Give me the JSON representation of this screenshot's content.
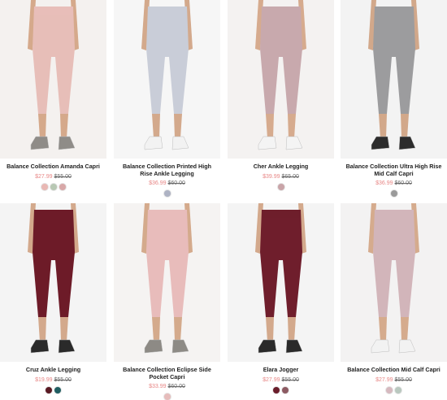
{
  "products": [
    {
      "title": "Balance Collection Amanda Capri",
      "sale": "$27.99",
      "orig": "$55.00",
      "swatches": [
        {
          "name": "blush",
          "color": "#e9b8b4"
        },
        {
          "name": "sage",
          "color": "#b8c8b4"
        },
        {
          "name": "rose",
          "color": "#d8a8a8"
        }
      ],
      "image": {
        "bg": "#f4f1ef",
        "fabric": "#e7beb8",
        "shoe": "#8f8c88",
        "skin": "#d5a98b"
      }
    },
    {
      "title": "Balance Collection Printed High Rise Ankle Legging",
      "sale": "$36.99",
      "orig": "$60.00",
      "swatches": [
        {
          "name": "camo-print",
          "color": "#aeb3c4"
        }
      ],
      "image": {
        "bg": "#f6f6f6",
        "fabric": "#c9cdd8",
        "shoe": "#f2f2f2",
        "skin": "#d3a98c"
      }
    },
    {
      "title": "Cher Ankle Legging",
      "sale": "$39.99",
      "orig": "$65.00",
      "swatches": [
        {
          "name": "mauve",
          "color": "#c9a4a8"
        }
      ],
      "image": {
        "bg": "#f4f2f1",
        "fabric": "#c8a9ad",
        "shoe": "#f4f4f4",
        "skin": "#d6ab8e"
      }
    },
    {
      "title": "Balance Collection Ultra High Rise Mid Calf Capri",
      "sale": "$36.99",
      "orig": "$60.00",
      "swatches": [
        {
          "name": "grey",
          "color": "#9a9a9a"
        }
      ],
      "image": {
        "bg": "#f3f3f3",
        "fabric": "#9c9c9e",
        "shoe": "#2c2c2c",
        "skin": "#d2a88a"
      }
    },
    {
      "title": "Cruz Ankle Legging",
      "sale": "$19.99",
      "orig": "$55.00",
      "swatches": [
        {
          "name": "wine",
          "color": "#5a1a23"
        },
        {
          "name": "teal",
          "color": "#1f5d61"
        }
      ],
      "image": {
        "bg": "#f4f4f4",
        "fabric": "#6d1b28",
        "shoe": "#2a2a2a",
        "skin": "#d3a98c"
      }
    },
    {
      "title": "Balance Collection Eclipse Side Pocket Capri",
      "sale": "$33.99",
      "orig": "$60.00",
      "swatches": [
        {
          "name": "blush",
          "color": "#e6bcbb"
        }
      ],
      "image": {
        "bg": "#f5f3f2",
        "fabric": "#e8bcbb",
        "shoe": "#8d8a85",
        "skin": "#d4aa8c"
      }
    },
    {
      "title": "Elara Jogger",
      "sale": "$27.99",
      "orig": "$55.00",
      "swatches": [
        {
          "name": "wine",
          "color": "#6a1d2a"
        },
        {
          "name": "mauve",
          "color": "#8c5a62"
        }
      ],
      "image": {
        "bg": "#f4f4f4",
        "fabric": "#6f1e2c",
        "shoe": "#2a2a2a",
        "skin": "#d3a98c"
      }
    },
    {
      "title": "Balance Collection Mid Calf Capri",
      "sale": "$27.99",
      "orig": "$55.00",
      "swatches": [
        {
          "name": "mauve",
          "color": "#d6b9bf"
        },
        {
          "name": "sage",
          "color": "#b9c8bf"
        }
      ],
      "image": {
        "bg": "#f3f2f2",
        "fabric": "#d2b5ba",
        "shoe": "#f2f2f2",
        "skin": "#d5ab8d"
      }
    }
  ]
}
